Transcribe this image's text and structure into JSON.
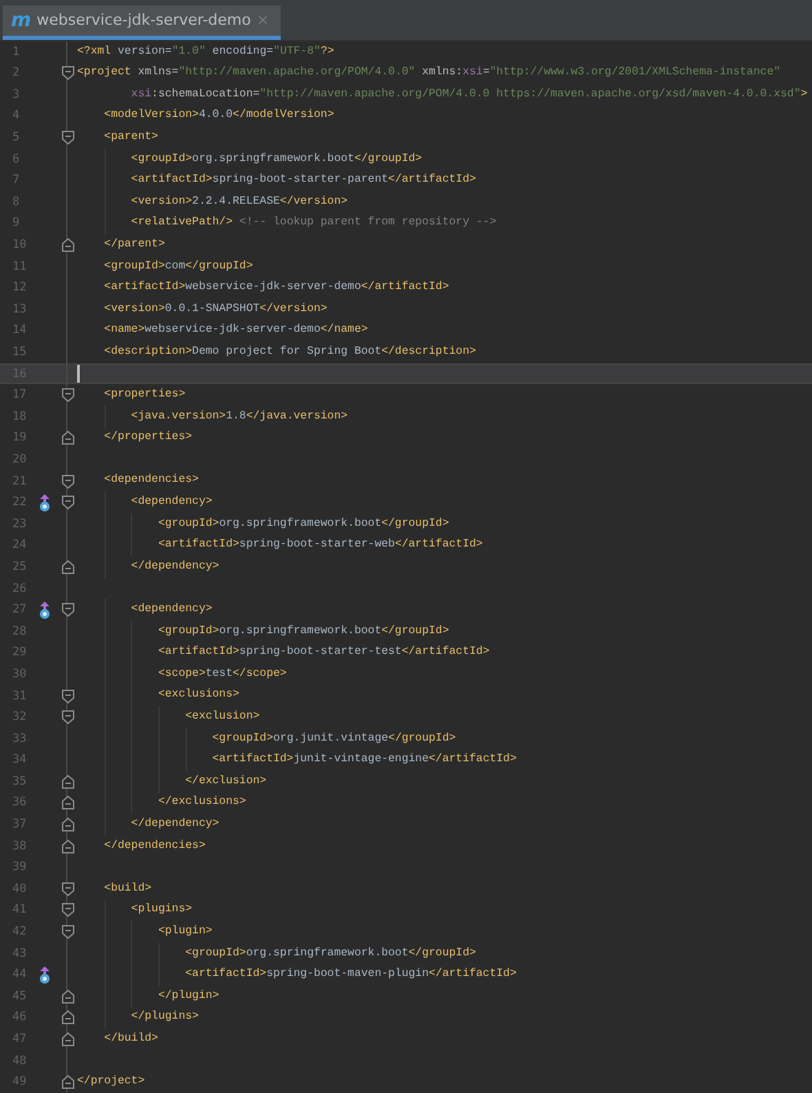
{
  "tab": {
    "icon": "m",
    "label": "webservice-jdk-server-demo",
    "close": "×",
    "selected": true
  },
  "lines": [
    {
      "n": "1",
      "kind": "plain",
      "current": false,
      "marker": false,
      "tokens": [
        {
          "kind": "tag",
          "t": "<?xml"
        },
        {
          "kind": "text",
          "t": " version="
        },
        {
          "kind": "value",
          "t": "\"1.0\""
        },
        {
          "kind": "text",
          "t": " encoding="
        },
        {
          "kind": "value",
          "t": "\"UTF-8\""
        },
        {
          "kind": "tag",
          "t": "?>"
        }
      ]
    },
    {
      "n": "2",
      "kind": "fold-open",
      "current": false,
      "marker": false,
      "tokens": [
        {
          "kind": "tag",
          "t": "<project"
        },
        {
          "kind": "attr",
          "t": " xmlns="
        },
        {
          "kind": "value",
          "t": "\"http://maven.apache.org/POM/4.0.0\""
        },
        {
          "kind": "attr",
          "t": " xmlns:"
        },
        {
          "kind": "ns",
          "t": "xsi"
        },
        {
          "kind": "attr",
          "t": "="
        },
        {
          "kind": "value",
          "t": "\"http://www.w3.org/2001/XMLSchema-instance\""
        }
      ]
    },
    {
      "n": "3",
      "kind": "plain",
      "current": false,
      "marker": false,
      "tokens": [
        {
          "kind": "ns",
          "t": "        xsi"
        },
        {
          "kind": "attr",
          "t": ":schemaLocation="
        },
        {
          "kind": "value",
          "t": "\"http://maven.apache.org/POM/4.0.0 https://maven.apache.org/xsd/maven-4.0.0.xsd\""
        },
        {
          "kind": "tag",
          "t": ">"
        }
      ]
    },
    {
      "n": "4",
      "kind": "plain",
      "current": false,
      "marker": false,
      "tokens": [
        {
          "kind": "tag",
          "t": "    <modelVersion>"
        },
        {
          "kind": "text",
          "t": "4.0.0"
        },
        {
          "kind": "tag",
          "t": "</modelVersion>"
        }
      ]
    },
    {
      "n": "5",
      "kind": "fold-open",
      "current": false,
      "marker": false,
      "tokens": [
        {
          "kind": "tag",
          "t": "    <parent>"
        }
      ]
    },
    {
      "n": "6",
      "kind": "plain",
      "current": false,
      "marker": false,
      "tokens": [
        {
          "kind": "tag",
          "t": "        <groupId>"
        },
        {
          "kind": "text",
          "t": "org.springframework.boot"
        },
        {
          "kind": "tag",
          "t": "</groupId>"
        }
      ]
    },
    {
      "n": "7",
      "kind": "plain",
      "current": false,
      "marker": false,
      "tokens": [
        {
          "kind": "tag",
          "t": "        <artifactId>"
        },
        {
          "kind": "text",
          "t": "spring-boot-starter-parent"
        },
        {
          "kind": "tag",
          "t": "</artifactId>"
        }
      ]
    },
    {
      "n": "8",
      "kind": "plain",
      "current": false,
      "marker": false,
      "tokens": [
        {
          "kind": "tag",
          "t": "        <version>"
        },
        {
          "kind": "text",
          "t": "2.2.4.RELEASE"
        },
        {
          "kind": "tag",
          "t": "</version>"
        }
      ]
    },
    {
      "n": "9",
      "kind": "plain",
      "current": false,
      "marker": false,
      "tokens": [
        {
          "kind": "tag",
          "t": "        <relativePath/>"
        },
        {
          "kind": "comment",
          "t": " <!-- lookup parent from repository -->"
        }
      ]
    },
    {
      "n": "10",
      "kind": "fold-close",
      "current": false,
      "marker": false,
      "tokens": [
        {
          "kind": "tag",
          "t": "    </parent>"
        }
      ]
    },
    {
      "n": "11",
      "kind": "plain",
      "current": false,
      "marker": false,
      "tokens": [
        {
          "kind": "tag",
          "t": "    <groupId>"
        },
        {
          "kind": "text",
          "t": "com"
        },
        {
          "kind": "tag",
          "t": "</groupId>"
        }
      ]
    },
    {
      "n": "12",
      "kind": "plain",
      "current": false,
      "marker": false,
      "tokens": [
        {
          "kind": "tag",
          "t": "    <artifactId>"
        },
        {
          "kind": "text",
          "t": "webservice-jdk-server-demo"
        },
        {
          "kind": "tag",
          "t": "</artifactId>"
        }
      ]
    },
    {
      "n": "13",
      "kind": "plain",
      "current": false,
      "marker": false,
      "tokens": [
        {
          "kind": "tag",
          "t": "    <version>"
        },
        {
          "kind": "text",
          "t": "0.0.1-SNAPSHOT"
        },
        {
          "kind": "tag",
          "t": "</version>"
        }
      ]
    },
    {
      "n": "14",
      "kind": "plain",
      "current": false,
      "marker": false,
      "tokens": [
        {
          "kind": "tag",
          "t": "    <name>"
        },
        {
          "kind": "text",
          "t": "webservice-jdk-server-demo"
        },
        {
          "kind": "tag",
          "t": "</name>"
        }
      ]
    },
    {
      "n": "15",
      "kind": "plain",
      "current": false,
      "marker": false,
      "tokens": [
        {
          "kind": "tag",
          "t": "    <description>"
        },
        {
          "kind": "text",
          "t": "Demo project for Spring Boot"
        },
        {
          "kind": "tag",
          "t": "</description>"
        }
      ]
    },
    {
      "n": "16",
      "kind": "plain",
      "current": true,
      "marker": false
    },
    {
      "n": "17",
      "kind": "fold-open",
      "current": false,
      "marker": false,
      "tokens": [
        {
          "kind": "tag",
          "t": "    <properties>"
        }
      ]
    },
    {
      "n": "18",
      "kind": "plain",
      "current": false,
      "marker": false,
      "tokens": [
        {
          "kind": "tag",
          "t": "        <java.version>"
        },
        {
          "kind": "text",
          "t": "1.8"
        },
        {
          "kind": "tag",
          "t": "</java.version>"
        }
      ]
    },
    {
      "n": "19",
      "kind": "fold-close",
      "current": false,
      "marker": false,
      "tokens": [
        {
          "kind": "tag",
          "t": "    </properties>"
        }
      ]
    },
    {
      "n": "20",
      "kind": "plain",
      "current": false,
      "marker": false
    },
    {
      "n": "21",
      "kind": "fold-open",
      "current": false,
      "marker": false,
      "tokens": [
        {
          "kind": "tag",
          "t": "    <dependencies>"
        }
      ]
    },
    {
      "n": "22",
      "kind": "fold-open",
      "current": false,
      "marker": true,
      "tokens": [
        {
          "kind": "tag",
          "t": "        <dependency>"
        }
      ]
    },
    {
      "n": "23",
      "kind": "plain",
      "current": false,
      "marker": false,
      "tokens": [
        {
          "kind": "tag",
          "t": "            <groupId>"
        },
        {
          "kind": "text",
          "t": "org.springframework.boot"
        },
        {
          "kind": "tag",
          "t": "</groupId>"
        }
      ]
    },
    {
      "n": "24",
      "kind": "plain",
      "current": false,
      "marker": false,
      "tokens": [
        {
          "kind": "tag",
          "t": "            <artifactId>"
        },
        {
          "kind": "text",
          "t": "spring-boot-starter-web"
        },
        {
          "kind": "tag",
          "t": "</artifactId>"
        }
      ]
    },
    {
      "n": "25",
      "kind": "fold-close",
      "current": false,
      "marker": false,
      "tokens": [
        {
          "kind": "tag",
          "t": "        </dependency>"
        }
      ]
    },
    {
      "n": "26",
      "kind": "plain",
      "current": false,
      "marker": false
    },
    {
      "n": "27",
      "kind": "fold-open",
      "current": false,
      "marker": true,
      "tokens": [
        {
          "kind": "tag",
          "t": "        <dependency>"
        }
      ]
    },
    {
      "n": "28",
      "kind": "plain",
      "current": false,
      "marker": false,
      "tokens": [
        {
          "kind": "tag",
          "t": "            <groupId>"
        },
        {
          "kind": "text",
          "t": "org.springframework.boot"
        },
        {
          "kind": "tag",
          "t": "</groupId>"
        }
      ]
    },
    {
      "n": "29",
      "kind": "plain",
      "current": false,
      "marker": false,
      "tokens": [
        {
          "kind": "tag",
          "t": "            <artifactId>"
        },
        {
          "kind": "text",
          "t": "spring-boot-starter-test"
        },
        {
          "kind": "tag",
          "t": "</artifactId>"
        }
      ]
    },
    {
      "n": "30",
      "kind": "plain",
      "current": false,
      "marker": false,
      "tokens": [
        {
          "kind": "tag",
          "t": "            <scope>"
        },
        {
          "kind": "text",
          "t": "test"
        },
        {
          "kind": "tag",
          "t": "</scope>"
        }
      ]
    },
    {
      "n": "31",
      "kind": "fold-open",
      "current": false,
      "marker": false,
      "tokens": [
        {
          "kind": "tag",
          "t": "            <exclusions>"
        }
      ]
    },
    {
      "n": "32",
      "kind": "fold-open",
      "current": false,
      "marker": false,
      "tokens": [
        {
          "kind": "tag",
          "t": "                <exclusion>"
        }
      ]
    },
    {
      "n": "33",
      "kind": "plain",
      "current": false,
      "marker": false,
      "tokens": [
        {
          "kind": "tag",
          "t": "                    <groupId>"
        },
        {
          "kind": "text",
          "t": "org.junit.vintage"
        },
        {
          "kind": "tag",
          "t": "</groupId>"
        }
      ]
    },
    {
      "n": "34",
      "kind": "plain",
      "current": false,
      "marker": false,
      "tokens": [
        {
          "kind": "tag",
          "t": "                    <artifactId>"
        },
        {
          "kind": "text",
          "t": "junit-vintage-engine"
        },
        {
          "kind": "tag",
          "t": "</artifactId>"
        }
      ]
    },
    {
      "n": "35",
      "kind": "fold-close",
      "current": false,
      "marker": false,
      "tokens": [
        {
          "kind": "tag",
          "t": "                </exclusion>"
        }
      ]
    },
    {
      "n": "36",
      "kind": "fold-close",
      "current": false,
      "marker": false,
      "tokens": [
        {
          "kind": "tag",
          "t": "            </exclusions>"
        }
      ]
    },
    {
      "n": "37",
      "kind": "fold-close",
      "current": false,
      "marker": false,
      "tokens": [
        {
          "kind": "tag",
          "t": "        </dependency>"
        }
      ]
    },
    {
      "n": "38",
      "kind": "fold-close",
      "current": false,
      "marker": false,
      "tokens": [
        {
          "kind": "tag",
          "t": "    </dependencies>"
        }
      ]
    },
    {
      "n": "39",
      "kind": "plain",
      "current": false,
      "marker": false
    },
    {
      "n": "40",
      "kind": "fold-open",
      "current": false,
      "marker": false,
      "tokens": [
        {
          "kind": "tag",
          "t": "    <build>"
        }
      ]
    },
    {
      "n": "41",
      "kind": "fold-open",
      "current": false,
      "marker": false,
      "tokens": [
        {
          "kind": "tag",
          "t": "        <plugins>"
        }
      ]
    },
    {
      "n": "42",
      "kind": "fold-open",
      "current": false,
      "marker": false,
      "tokens": [
        {
          "kind": "tag",
          "t": "            <plugin>"
        }
      ]
    },
    {
      "n": "43",
      "kind": "plain",
      "current": false,
      "marker": false,
      "tokens": [
        {
          "kind": "tag",
          "t": "                <groupId>"
        },
        {
          "kind": "text",
          "t": "org.springframework.boot"
        },
        {
          "kind": "tag",
          "t": "</groupId>"
        }
      ]
    },
    {
      "n": "44",
      "kind": "plain",
      "current": false,
      "marker": true,
      "tokens": [
        {
          "kind": "tag",
          "t": "                <artifactId>"
        },
        {
          "kind": "text",
          "t": "spring-boot-maven-plugin"
        },
        {
          "kind": "tag",
          "t": "</artifactId>"
        }
      ]
    },
    {
      "n": "45",
      "kind": "fold-close",
      "current": false,
      "marker": false,
      "tokens": [
        {
          "kind": "tag",
          "t": "            </plugin>"
        }
      ]
    },
    {
      "n": "46",
      "kind": "fold-close",
      "current": false,
      "marker": false,
      "tokens": [
        {
          "kind": "tag",
          "t": "        </plugins>"
        }
      ]
    },
    {
      "n": "47",
      "kind": "fold-close",
      "current": false,
      "marker": false,
      "tokens": [
        {
          "kind": "tag",
          "t": "    </build>"
        }
      ]
    },
    {
      "n": "48",
      "kind": "plain",
      "current": false,
      "marker": false
    },
    {
      "n": "49",
      "kind": "fold-close",
      "current": false,
      "marker": false,
      "tokens": [
        {
          "kind": "tag",
          "t": "</project>"
        }
      ]
    }
  ]
}
